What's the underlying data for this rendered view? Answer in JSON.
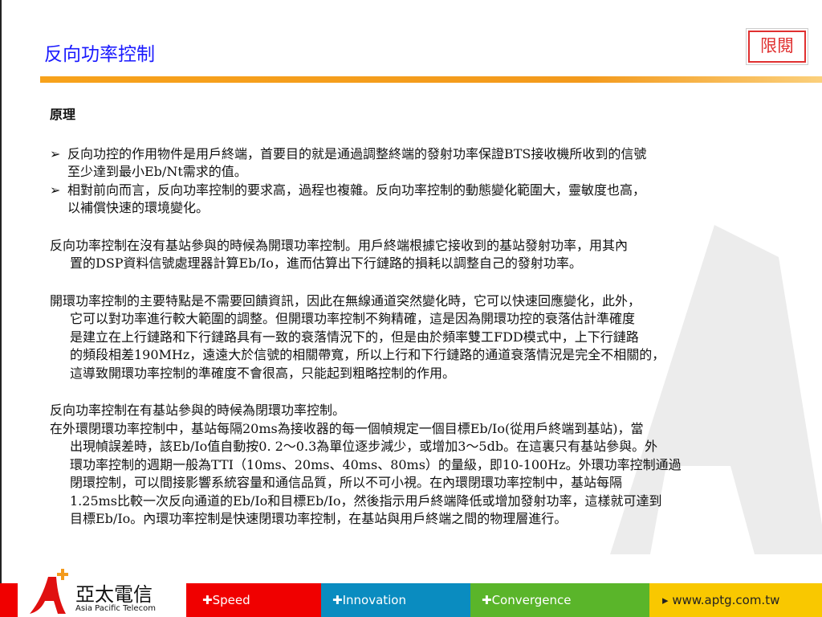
{
  "title": "反向功率控制",
  "stamp": "限閱",
  "heading": "原理",
  "bullets": [
    {
      "lines": [
        "反向功控的作用物件是用戶終端，首要目的就是通過調整終端的發射功率保證BTS接收機所收到的信號",
        "至少達到最小Eb/Nt需求的值。"
      ]
    },
    {
      "lines": [
        "相對前向而言，反向功率控制的要求高，過程也複雜。反向功率控制的動態變化範圍大，靈敏度也高，",
        "以補償快速的環境變化。"
      ]
    }
  ],
  "paragraphs": [
    {
      "lines": [
        "反向功率控制在沒有基站參與的時候為開環功率控制。用戶終端根據它接收到的基站發射功率，用其內",
        "置的DSP資料信號處理器計算Eb/Io，進而估算出下行鏈路的損耗以調整自己的發射功率。"
      ]
    },
    {
      "lines": [
        "開環功率控制的主要特點是不需要回饋資訊，因此在無線通道突然變化時，它可以快速回應變化，此外，",
        "它可以對功率進行較大範圍的調整。但開環功率控制不夠精確，這是因為開環功控的衰落估計準確度",
        "是建立在上行鏈路和下行鏈路具有一致的衰落情況下的，但是由於頻率雙工FDD模式中，上下行鏈路",
        "的頻段相差190MHz，遠遠大於信號的相關帶寬，所以上行和下行鏈路的通道衰落情況是完全不相關的，",
        "這導致開環功率控制的準確度不會很高，只能起到粗略控制的作用。"
      ]
    },
    {
      "lines": [
        "反向功率控制在有基站參與的時候為閉環功率控制。"
      ]
    },
    {
      "lines": [
        "在外環閉環功率控制中，基站每隔20ms為接收器的每一個幀規定一個目標Eb/Io(從用戶終端到基站)，當",
        "出現幀誤差時，該Eb/Io值自動按0. 2～0.3為單位逐步減少，或增加3～5db。在這裏只有基站參與。外",
        "環功率控制的週期一般為TTI（10ms、20ms、40ms、80ms）的量級，即10-100Hz。外環功率控制通過",
        "閉環控制，可以間接影響系統容量和通信品質，所以不可小視。在內環閉環功率控制中，基站每隔",
        "1.25ms比較一次反向通道的Eb/Io和目標Eb/Io，然後指示用戶終端降低或增加發射功率，這樣就可達到",
        "目標Eb/Io。內環功率控制是快速閉環功率控制，在基站與用戶終端之間的物理層進行。"
      ]
    }
  ],
  "footer": {
    "logo_cn": "亞太電信",
    "logo_en": "Asia Pacific Telecom",
    "speed": "Speed",
    "innovation": "Innovation",
    "convergence": "Convergence",
    "url": "www.aptg.com.tw",
    "colors": {
      "red": "#f00000",
      "blue": "#0a8cc0",
      "green": "#5ab52a",
      "yellow": "#f9c800"
    }
  }
}
